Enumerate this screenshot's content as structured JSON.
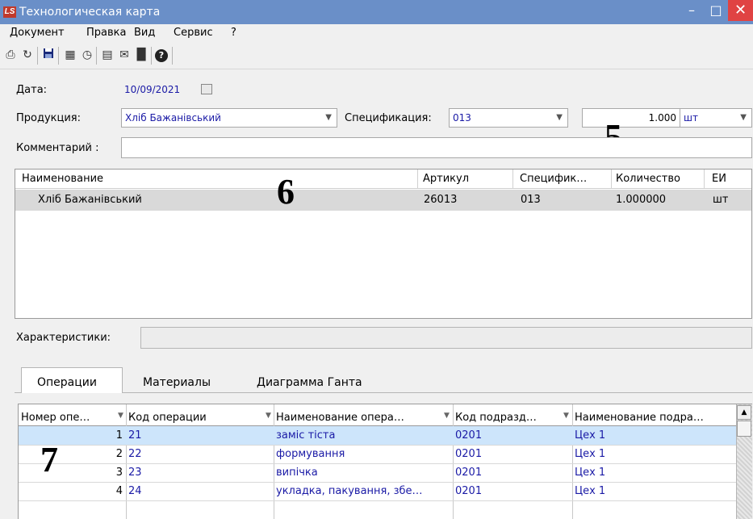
{
  "window": {
    "title": "Технологическая карта",
    "logo": "LS"
  },
  "menu": [
    "Документ",
    "Правка",
    "Вид",
    "Сервис",
    "?"
  ],
  "toolbar_icons": [
    "print-icon",
    "refresh-icon",
    "save-icon",
    "table-icon",
    "calc-icon",
    "form-icon",
    "mail-icon",
    "barcode-icon",
    "help-icon"
  ],
  "form": {
    "date_label": "Дата:",
    "date_value": "10/09/2021",
    "product_label": "Продукция:",
    "product_value": "Хліб Бажанівський",
    "spec_label": "Спецификация:",
    "spec_value": "013",
    "qty_value": "1.000",
    "unit_value": "шт",
    "comment_label": "Комментарий :",
    "comment_value": "",
    "chars_label": "Характеристики:"
  },
  "annotations": {
    "n5": "5",
    "n6": "6",
    "n7": "7"
  },
  "top_grid": {
    "columns": [
      "Наименование",
      "Артикул",
      "Специфик…",
      "Количество",
      "ЕИ"
    ],
    "rows": [
      {
        "name": "Хліб Бажанівський",
        "article": "26013",
        "spec": "013",
        "qty": "1.000000",
        "unit": "шт"
      }
    ]
  },
  "tabs": [
    "Операции",
    "Материалы",
    "Диаграмма Ганта"
  ],
  "ops_grid": {
    "columns": [
      "Номер опе…",
      "Код операции",
      "Наименование опера…",
      "Код подразд…",
      "Наименование подра…"
    ],
    "rows": [
      {
        "num": "1",
        "code": "21",
        "name": "заміс тіста",
        "dept_code": "0201",
        "dept_name": "Цех 1"
      },
      {
        "num": "2",
        "code": "22",
        "name": "формування",
        "dept_code": "0201",
        "dept_name": "Цех 1"
      },
      {
        "num": "3",
        "code": "23",
        "name": "випічка",
        "dept_code": "0201",
        "dept_name": "Цех 1"
      },
      {
        "num": "4",
        "code": "24",
        "name": "укладка, пакування, збе…",
        "dept_code": "0201",
        "dept_name": "Цех 1"
      }
    ]
  },
  "colors": {
    "titlebar": "#6a8fc8",
    "selected_row": "#cde5fb",
    "close": "#e04343",
    "value_text": "#1a1aa6"
  }
}
